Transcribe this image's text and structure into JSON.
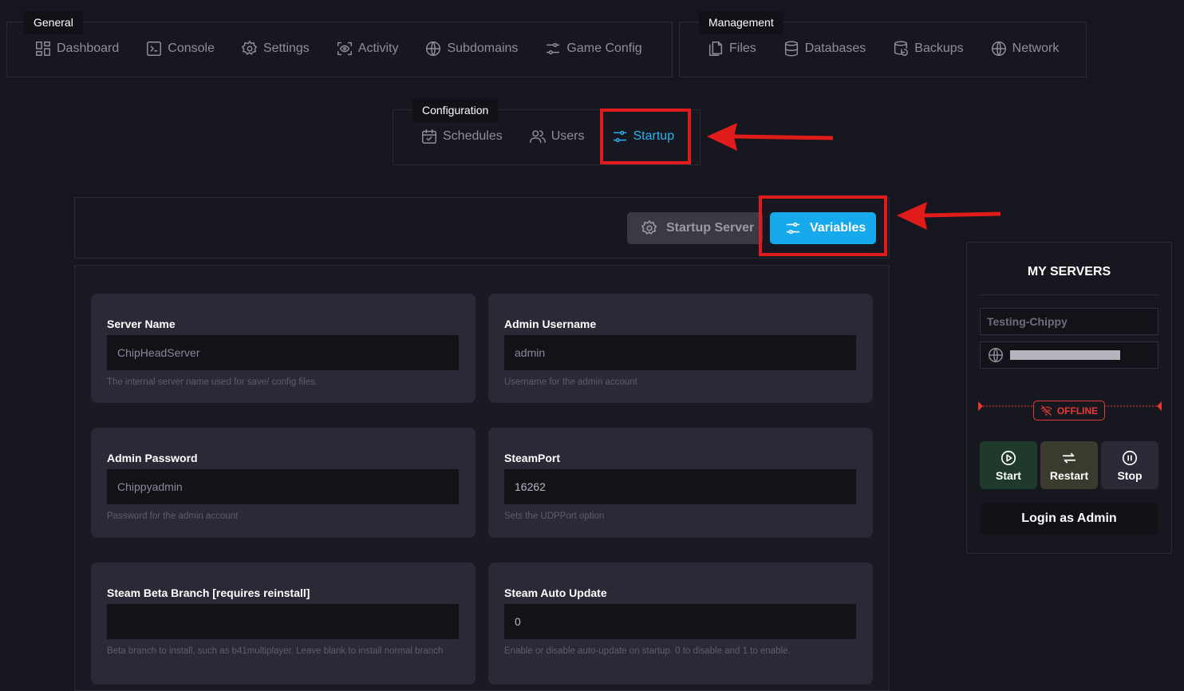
{
  "nav_general": {
    "title": "General",
    "items": [
      {
        "label": "Dashboard",
        "icon": "dashboard-icon"
      },
      {
        "label": "Console",
        "icon": "console-icon"
      },
      {
        "label": "Settings",
        "icon": "gear-icon"
      },
      {
        "label": "Activity",
        "icon": "eye-icon"
      },
      {
        "label": "Subdomains",
        "icon": "globe-icon"
      },
      {
        "label": "Game Config",
        "icon": "sliders-icon"
      }
    ]
  },
  "nav_management": {
    "title": "Management",
    "items": [
      {
        "label": "Files",
        "icon": "files-icon"
      },
      {
        "label": "Databases",
        "icon": "database-icon"
      },
      {
        "label": "Backups",
        "icon": "backup-icon"
      },
      {
        "label": "Network",
        "icon": "globe-icon"
      }
    ]
  },
  "nav_configuration": {
    "title": "Configuration",
    "items": [
      {
        "label": "Schedules",
        "icon": "calendar-icon"
      },
      {
        "label": "Users",
        "icon": "users-icon"
      },
      {
        "label": "Startup",
        "icon": "sliders-icon",
        "active": true
      }
    ]
  },
  "toolbar": {
    "startup_server_label": "Startup Server",
    "variables_label": "Variables"
  },
  "variables": [
    {
      "label": "Server Name",
      "value": "ChipHeadServer",
      "help": "The internal server name used for save/ config files."
    },
    {
      "label": "Admin Username",
      "value": "admin",
      "help": "Username for the admin account"
    },
    {
      "label": "Admin Password",
      "value": "Chippyadmin",
      "help": "Password for the admin account"
    },
    {
      "label": "SteamPort",
      "value": "16262",
      "help": "Sets the UDPPort option"
    },
    {
      "label": "Steam Beta Branch [requires reinstall]",
      "value": "",
      "help": "Beta branch to install, such as b41multiplayer. Leave blank to install normal branch"
    },
    {
      "label": "Steam Auto Update",
      "value": "0",
      "help": "Enable or disable auto-update on startup. 0 to disable and 1 to enable."
    }
  ],
  "sidebar": {
    "title": "MY SERVERS",
    "server_name": "Testing-Chippy",
    "status": "OFFLINE",
    "start_label": "Start",
    "restart_label": "Restart",
    "stop_label": "Stop",
    "login_label": "Login as Admin"
  },
  "colors": {
    "accent": "#2bb3f0",
    "annotation_red": "#e01b1b",
    "offline_red": "#e53935",
    "start_bg": "#1f3a2a",
    "restart_bg": "#3a3a2e",
    "stop_bg": "#2a2a36"
  }
}
